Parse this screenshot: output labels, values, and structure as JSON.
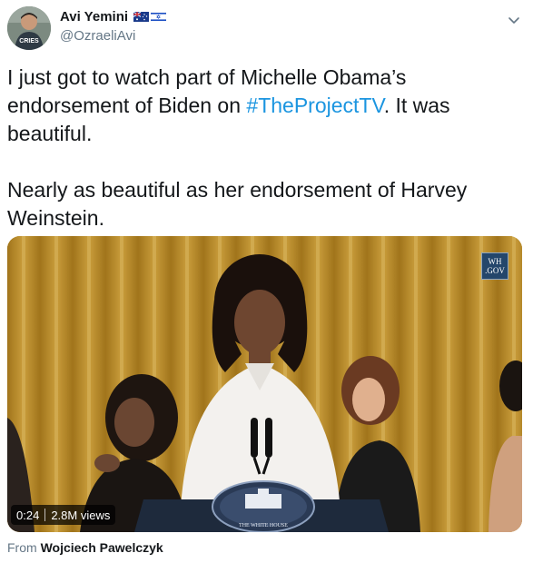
{
  "author": {
    "name": "Avi Yemini",
    "handle": "@OzraeliAvi",
    "avatar_text": "CRIES",
    "flags": [
      "australia-flag",
      "israel-flag"
    ]
  },
  "tweet": {
    "text_part1": "I just got to watch part of Michelle Obama’s endorsement of Biden on ",
    "hashtag": "#TheProjectTV",
    "text_part2": ". It was beautiful.",
    "paragraph2": "Nearly as beautiful as her endorsement of Harvey Weinstein."
  },
  "media": {
    "badge_line1": "WH",
    "badge_line2": ".GOV",
    "podium_text": "THE WHITE HOUSE",
    "duration": "0:24",
    "views": "2.8M views"
  },
  "source": {
    "prefix": "From",
    "name": "Wojciech Pawelczyk"
  },
  "colors": {
    "link": "#1b95e0",
    "secondary_text": "#657786",
    "primary_text": "#14171a"
  }
}
